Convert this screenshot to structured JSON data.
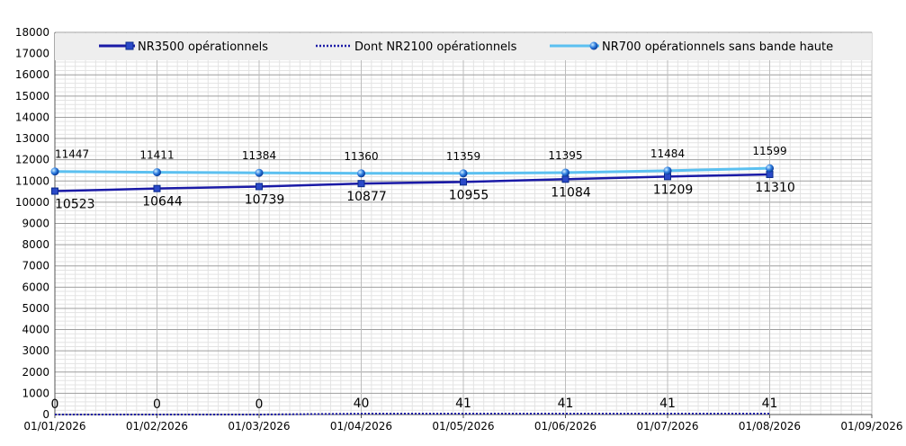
{
  "chart_data": {
    "type": "line",
    "x": [
      "01/01/2026",
      "01/02/2026",
      "01/03/2026",
      "01/04/2026",
      "01/05/2026",
      "01/06/2026",
      "01/07/2026",
      "01/08/2026"
    ],
    "x_ticks": [
      "01/01/2026",
      "01/02/2026",
      "01/03/2026",
      "01/04/2026",
      "01/05/2026",
      "01/06/2026",
      "01/07/2026",
      "01/08/2026",
      "01/09/2026"
    ],
    "ylim": [
      0,
      18000
    ],
    "y_ticks": [
      0,
      1000,
      2000,
      3000,
      4000,
      5000,
      6000,
      7000,
      8000,
      9000,
      10000,
      11000,
      12000,
      13000,
      14000,
      15000,
      16000,
      17000,
      18000
    ],
    "grid": true,
    "legend_position": "top",
    "series": [
      {
        "name": "NR3500 opérationnels",
        "values": [
          10523,
          10644,
          10739,
          10877,
          10955,
          11084,
          11209,
          11310
        ],
        "color": "#1a1aa6",
        "line_style": "solid",
        "marker": "square"
      },
      {
        "name": "Dont NR2100 opérationnels",
        "values": [
          0,
          0,
          0,
          40,
          41,
          41,
          41,
          41
        ],
        "color": "#1a1aa6",
        "line_style": "dotted",
        "marker": "none"
      },
      {
        "name": "NR700 opérationnels sans bande haute",
        "values": [
          11447,
          11411,
          11384,
          11360,
          11359,
          11395,
          11484,
          11599
        ],
        "color": "#5bc0f0",
        "line_style": "solid",
        "marker": "circle"
      }
    ]
  }
}
